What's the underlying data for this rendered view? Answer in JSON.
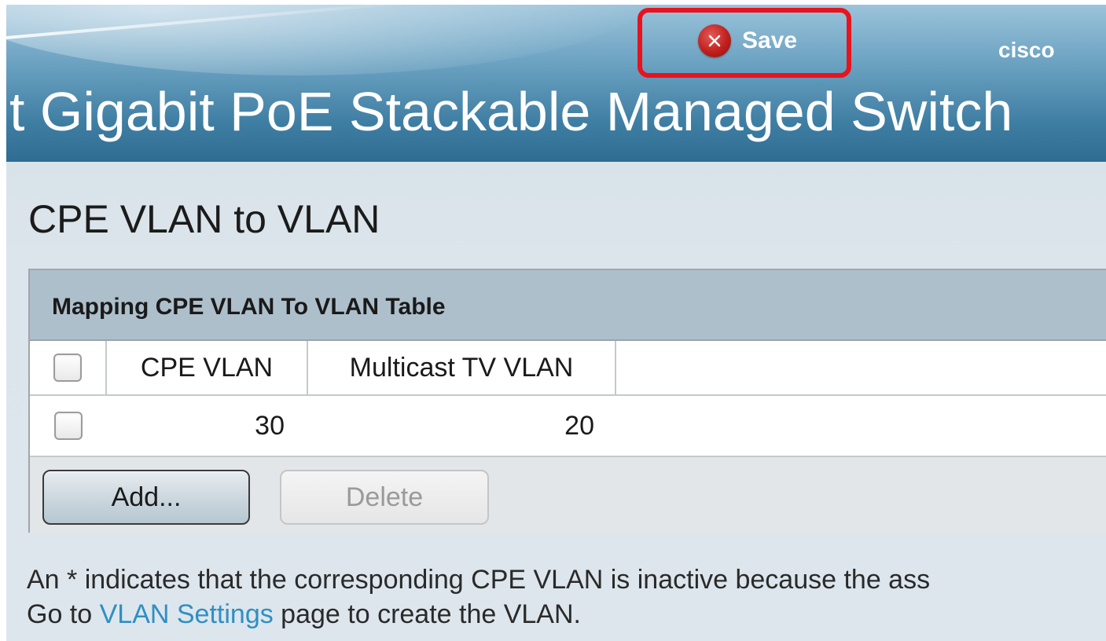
{
  "header": {
    "product_title": "t Gigabit PoE Stackable Managed Switch",
    "brand": "cisco",
    "save_label": "Save",
    "save_icon": "close-circle-icon",
    "save_icon_color": "#c0201d",
    "highlight_color": "#e8131d"
  },
  "page": {
    "title": "CPE VLAN to VLAN"
  },
  "table": {
    "caption": "Mapping CPE VLAN To VLAN Table",
    "columns": [
      "CPE VLAN",
      "Multicast TV VLAN"
    ],
    "rows": [
      {
        "cpe_vlan": "30",
        "multicast_tv_vlan": "20"
      }
    ],
    "buttons": {
      "add": "Add...",
      "delete": "Delete"
    }
  },
  "note": {
    "line1": "An * indicates that the corresponding CPE VLAN is inactive because the ass",
    "line2_prefix": "Go to ",
    "line2_link": "VLAN Settings",
    "line2_suffix": " page to create the VLAN.",
    "link_color": "#2f8fc4"
  }
}
